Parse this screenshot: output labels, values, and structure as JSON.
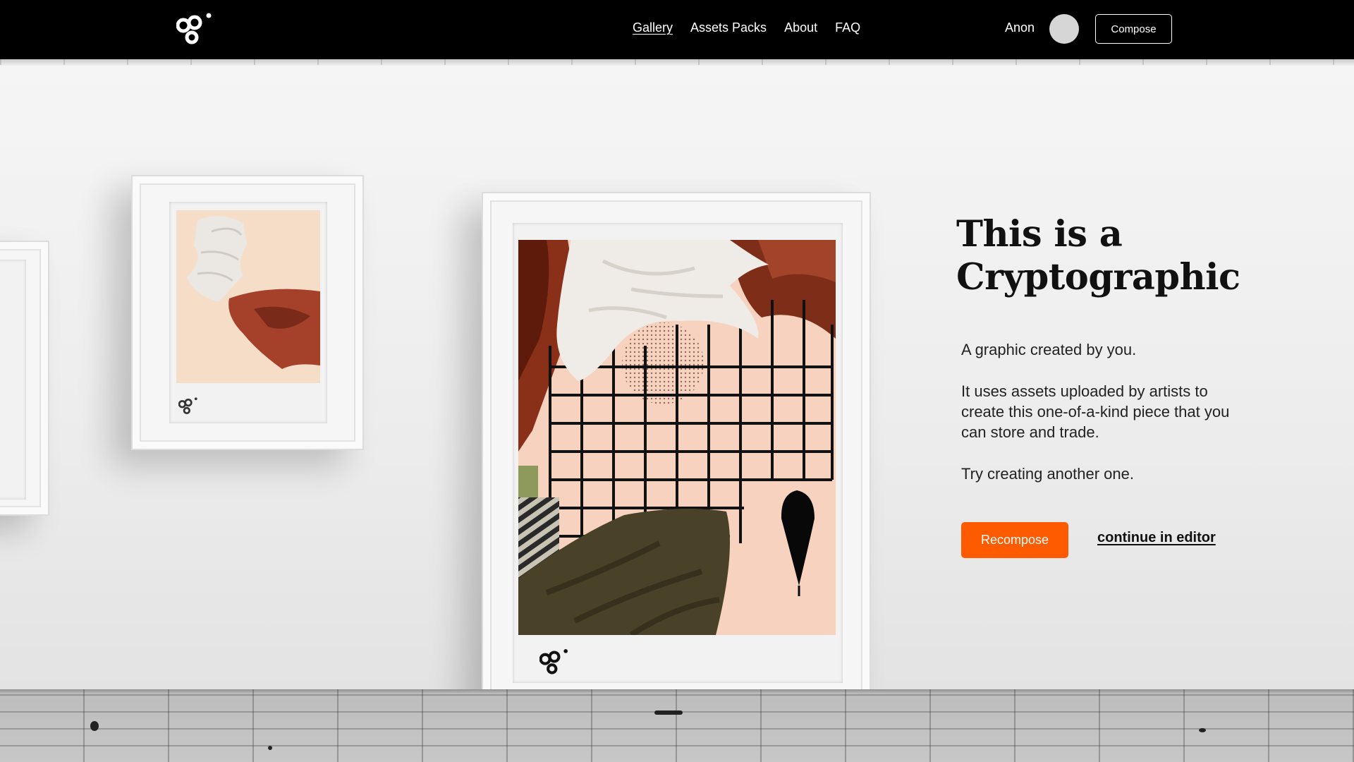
{
  "nav": {
    "logo_icon": "cryptographics-logo-icon",
    "links": [
      {
        "label": "Gallery",
        "active": true
      },
      {
        "label": "Assets Packs",
        "active": false
      },
      {
        "label": "About",
        "active": false
      },
      {
        "label": "FAQ",
        "active": false
      }
    ],
    "user_name": "Anon",
    "compose_label": "Compose"
  },
  "hero": {
    "title_line1": "This is a",
    "title_line2": "Cryptographic",
    "paragraphs": [
      "A graphic created by you.",
      "It uses assets uploaded by artists to create this one-of-a-kind piece that you can store and trade.",
      "Try creating another one."
    ],
    "recompose_label": "Recompose",
    "editor_link_label": "continue in editor"
  },
  "colors": {
    "accent": "#fe5a00",
    "nav_bg": "#000000",
    "artwork_bg": "#f7d3bf"
  }
}
